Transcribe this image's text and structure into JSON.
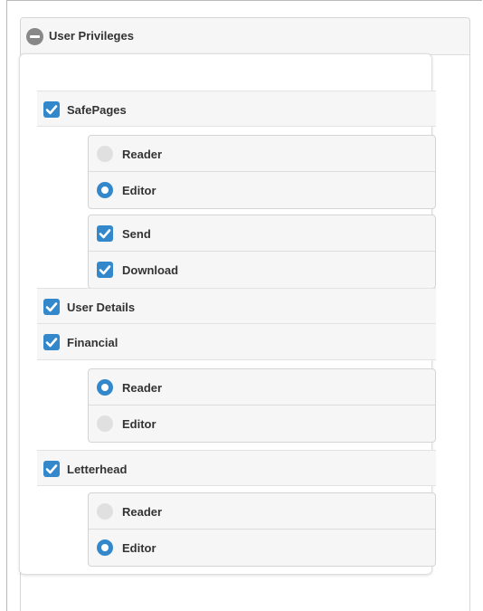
{
  "panel": {
    "title": "User Privileges",
    "collapse_icon": "minus-circle-icon"
  },
  "colors": {
    "accent": "#3388cc",
    "radio_off": "#e0e0e0",
    "header_bg": "#f6f6f6"
  },
  "privileges": [
    {
      "label": "SafePages",
      "checked": true,
      "role_options": [
        {
          "label": "Reader",
          "selected": false
        },
        {
          "label": "Editor",
          "selected": true
        }
      ],
      "permissions": [
        {
          "label": "Send",
          "checked": true
        },
        {
          "label": "Download",
          "checked": true
        }
      ]
    },
    {
      "label": "User Details",
      "checked": true
    },
    {
      "label": "Financial",
      "checked": true,
      "role_options": [
        {
          "label": "Reader",
          "selected": true
        },
        {
          "label": "Editor",
          "selected": false
        }
      ]
    },
    {
      "label": "Letterhead",
      "checked": true,
      "role_options": [
        {
          "label": "Reader",
          "selected": false
        },
        {
          "label": "Editor",
          "selected": true
        }
      ]
    }
  ]
}
